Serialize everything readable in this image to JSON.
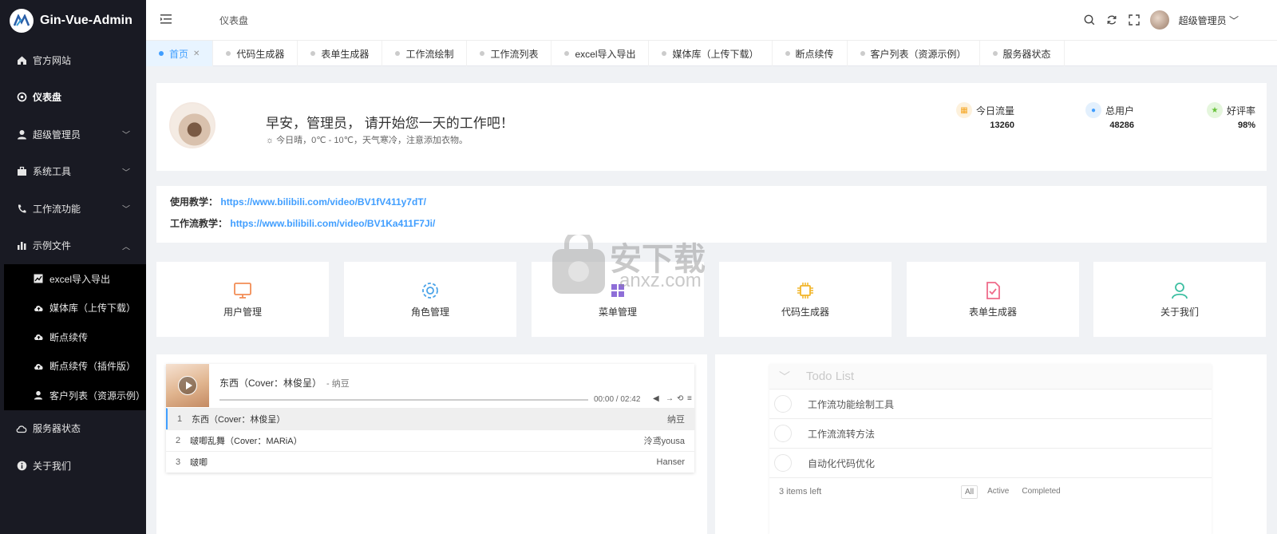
{
  "app": {
    "logo_text": "Gin-Vue-Admin",
    "brand_color": "#409eff"
  },
  "sidebar": {
    "items": [
      {
        "label": "官方网站",
        "icon": "home-icon"
      },
      {
        "label": "仪表盘",
        "icon": "gauge-icon"
      },
      {
        "label": "超级管理员",
        "icon": "user-icon"
      },
      {
        "label": "系统工具",
        "icon": "toolbox-icon"
      },
      {
        "label": "工作流功能",
        "icon": "phone-icon"
      },
      {
        "label": "示例文件",
        "icon": "chart-icon"
      },
      {
        "label": "服务器状态",
        "icon": "cloud-icon"
      },
      {
        "label": "关于我们",
        "icon": "info-icon"
      }
    ],
    "submenu": [
      {
        "label": "excel导入导出",
        "icon": "excel-icon"
      },
      {
        "label": "媒体库（上传下载）",
        "icon": "upload-icon"
      },
      {
        "label": "断点续传",
        "icon": "upload-icon"
      },
      {
        "label": "断点续传（插件版）",
        "icon": "upload-icon"
      },
      {
        "label": "客户列表（资源示例）",
        "icon": "user-icon"
      }
    ]
  },
  "header": {
    "breadcrumb": "仪表盘",
    "user_name": "超级管理员"
  },
  "tabs": [
    {
      "label": "首页"
    },
    {
      "label": "代码生成器"
    },
    {
      "label": "表单生成器"
    },
    {
      "label": "工作流绘制"
    },
    {
      "label": "工作流列表"
    },
    {
      "label": "excel导入导出"
    },
    {
      "label": "媒体库（上传下载）"
    },
    {
      "label": "断点续传"
    },
    {
      "label": "客户列表（资源示例）"
    },
    {
      "label": "服务器状态"
    }
  ],
  "welcome": {
    "greeting": "早安，管理员， 请开始您一天的工作吧！",
    "weather": "今日晴，0℃ - 10℃，天气寒冷，注意添加衣物。"
  },
  "stats": [
    {
      "label": "今日流量",
      "value": "13260",
      "color": "#f5a623"
    },
    {
      "label": "总用户",
      "value": "48286",
      "color": "#409eff"
    },
    {
      "label": "好评率",
      "value": "98%",
      "color": "#67c23a"
    }
  ],
  "links": {
    "tutorial_label": "使用教学：",
    "tutorial_url": "https://www.bilibili.com/video/BV1fV411y7dT/",
    "workflow_label": "工作流教学：",
    "workflow_url": "https://www.bilibili.com/video/BV1Ka411F7Ji/"
  },
  "quick_links": [
    {
      "label": "用户管理",
      "icon": "monitor-icon",
      "color": "#f28d56"
    },
    {
      "label": "角色管理",
      "icon": "gear-icon",
      "color": "#4aa3e8"
    },
    {
      "label": "菜单管理",
      "icon": "menu-icon",
      "color": "#8e6ed8"
    },
    {
      "label": "代码生成器",
      "icon": "chip-icon",
      "color": "#f2b52a"
    },
    {
      "label": "表单生成器",
      "icon": "document-check-icon",
      "color": "#ef6b8a"
    },
    {
      "label": "关于我们",
      "icon": "user-icon",
      "color": "#3dbfa2"
    }
  ],
  "player": {
    "title": "东西（Cover：林俊呈）",
    "artist": "- 纳豆",
    "time": "00:00 / 02:42",
    "playlist": [
      {
        "num": "1",
        "title": "东西（Cover：林俊呈）",
        "artist": "纳豆"
      },
      {
        "num": "2",
        "title": "啵唧乱舞（Cover：MARiA）",
        "artist": "泠鸢yousa"
      },
      {
        "num": "3",
        "title": "啵唧",
        "artist": "Hanser"
      }
    ]
  },
  "todo": {
    "placeholder": "Todo List",
    "items": [
      {
        "text": "工作流功能绘制工具"
      },
      {
        "text": "工作流流转方法"
      },
      {
        "text": "自动化代码优化"
      }
    ],
    "items_left": "3 items left",
    "filters": [
      "All",
      "Active",
      "Completed"
    ]
  },
  "watermark": {
    "text_cn": "安下载",
    "text_en": "anxz.com"
  }
}
